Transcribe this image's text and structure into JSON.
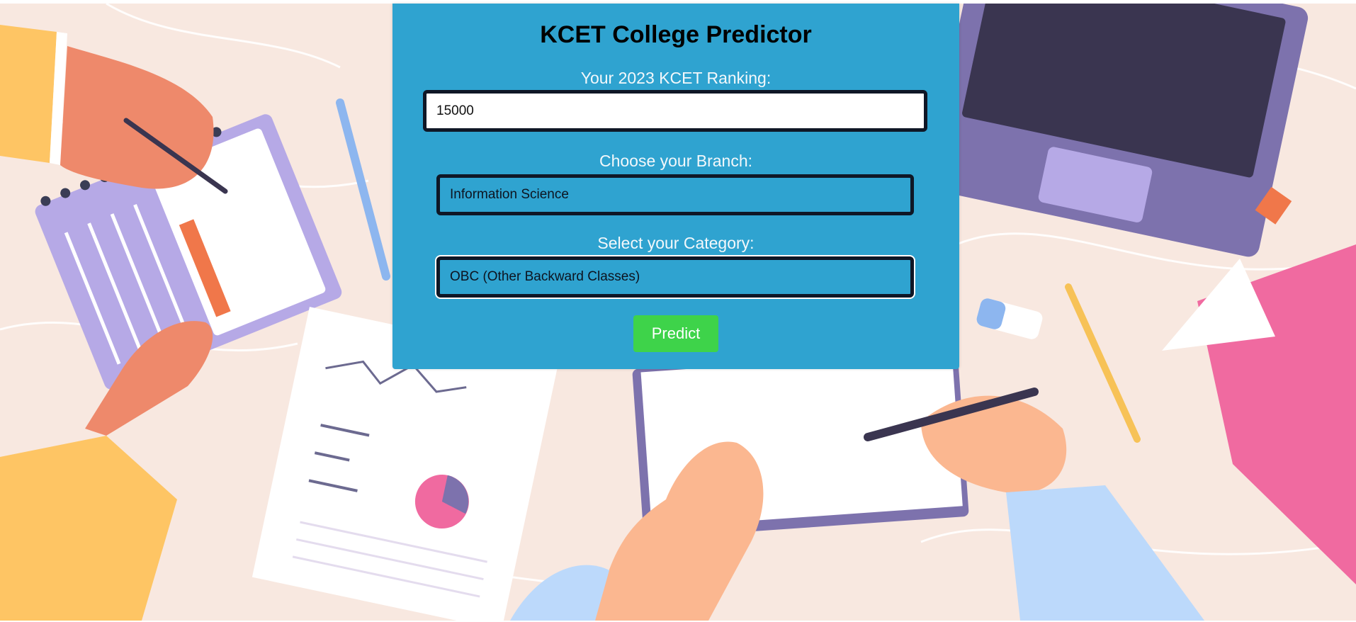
{
  "page": {
    "title": "KCET College Predictor"
  },
  "form": {
    "rank_label": "Your 2023 KCET Ranking:",
    "rank_value": "15000",
    "branch_label": "Choose your Branch:",
    "branch_selected": "Information Science",
    "category_label": "Select your Category:",
    "category_selected": "OBC (Other Backward Classes)",
    "predict_label": "Predict"
  },
  "colors": {
    "card_background": "#2fa3d0",
    "predict_button": "#3ed34a",
    "field_border": "#0f1726",
    "page_background": "#f8e8e0"
  },
  "icons": {
    "background": "desk-study-illustration"
  }
}
